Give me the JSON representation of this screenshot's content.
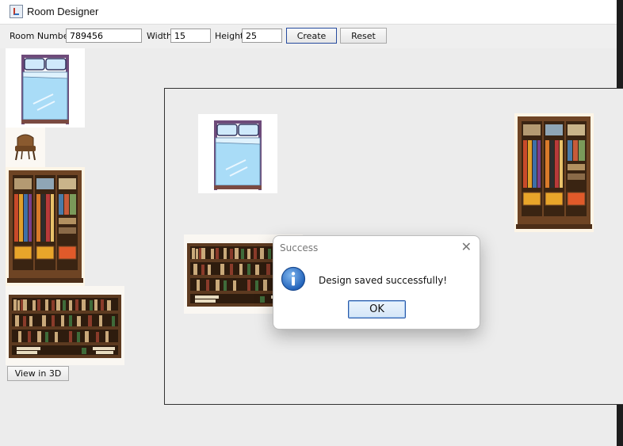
{
  "window": {
    "title": "Room Designer"
  },
  "toolbar": {
    "room_number_label": "Room Number",
    "room_number_value": "789456",
    "width_label": "Width",
    "width_value": "15",
    "height_label": "Height",
    "height_value": "25",
    "create_label": "Create",
    "reset_label": "Reset"
  },
  "palette": {
    "items": [
      "bed",
      "armchair",
      "wardrobe",
      "bookshelf"
    ],
    "view3d_label": "View in 3D"
  },
  "canvas": {
    "placed_items": [
      "bed",
      "wardrobe",
      "bookshelf"
    ]
  },
  "dialog": {
    "title": "Success",
    "close_glyph": "✕",
    "message": "Design saved successfully!",
    "ok_label": "OK",
    "icon": "info-icon"
  },
  "colors": {
    "button_focus_border": "#274b9e",
    "dialog_ok_border": "#2a5aa8",
    "info_blue": "#1e5fb8"
  }
}
